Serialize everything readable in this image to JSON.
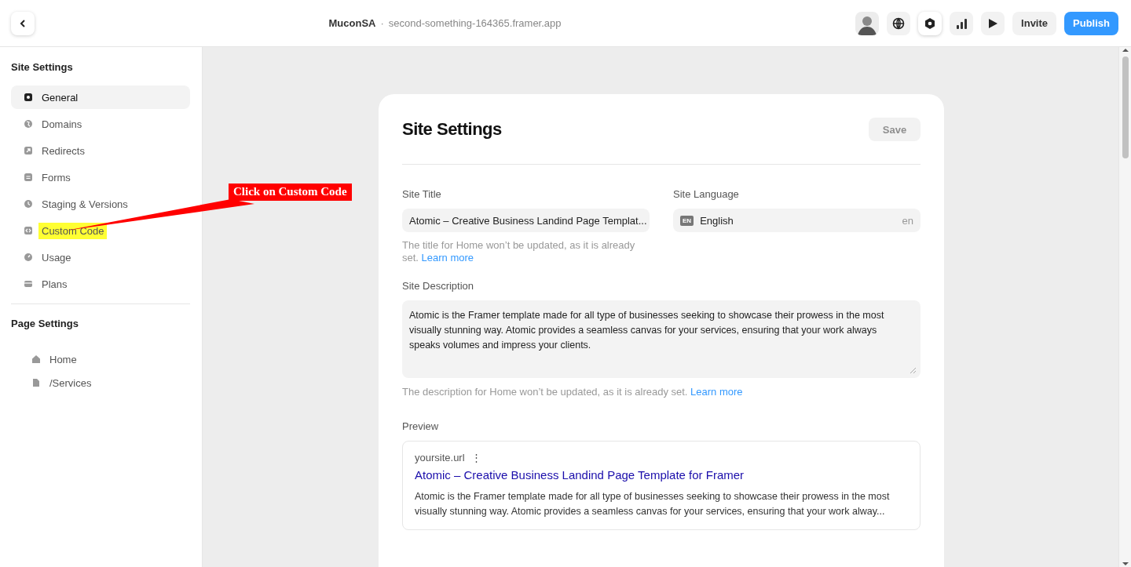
{
  "topbar": {
    "project": "MuconSA",
    "separator": "·",
    "url": "second-something-164365.framer.app",
    "tools": [
      {
        "selected": false
      },
      {
        "selected": true
      },
      {
        "selected": false
      },
      {
        "selected": false
      }
    ],
    "buttons": [
      {
        "label": "Invite",
        "kind": "secondary"
      },
      {
        "label": "Publish",
        "kind": "primary"
      }
    ]
  },
  "sidebar": {
    "site_heading": "Site Settings",
    "site_items": [
      {
        "label": "General",
        "selected": true,
        "highlighted": false
      },
      {
        "label": "Domains",
        "selected": false,
        "highlighted": false
      },
      {
        "label": "Redirects",
        "selected": false,
        "highlighted": false
      },
      {
        "label": "Forms",
        "selected": false,
        "highlighted": false
      },
      {
        "label": "Staging & Versions",
        "selected": false,
        "highlighted": false
      },
      {
        "label": "Custom Code",
        "selected": false,
        "highlighted": true
      },
      {
        "label": "Usage",
        "selected": false,
        "highlighted": false
      },
      {
        "label": "Plans",
        "selected": false,
        "highlighted": false
      }
    ],
    "page_heading": "Page Settings",
    "page_items": [
      {
        "label": "Home"
      },
      {
        "label": "/Services"
      }
    ]
  },
  "annotation": {
    "text": "Click on Custom Code"
  },
  "card": {
    "title": "Site Settings",
    "save": {
      "label": "Save",
      "disabled": true
    },
    "site_title": {
      "label": "Site Title",
      "value": "Atomic – Creative Business Landind Page Templat...",
      "note": "The title for Home won’t be updated, as it is already set.",
      "link": "Learn more"
    },
    "site_language": {
      "label": "Site Language",
      "badge": "EN",
      "value": "English",
      "code": "en"
    },
    "site_description": {
      "label": "Site Description",
      "value": "Atomic is the Framer template made for all type of businesses seeking to showcase their prowess in the most visually stunning way. Atomic provides a seamless canvas for your services, ensuring that your work always speaks volumes and impress your clients.",
      "note": "The description for Home won’t be updated, as it is already set.",
      "link": "Learn more"
    },
    "preview": {
      "label": "Preview",
      "url": "yoursite.url",
      "menu": "⋮",
      "title": "Atomic – Creative Business Landind Page Template for Framer",
      "description": "Atomic is the Framer template made for all type of businesses seeking to showcase their prowess in the most visually stunning way. Atomic provides a seamless canvas for your services, ensuring that your work alway..."
    }
  }
}
